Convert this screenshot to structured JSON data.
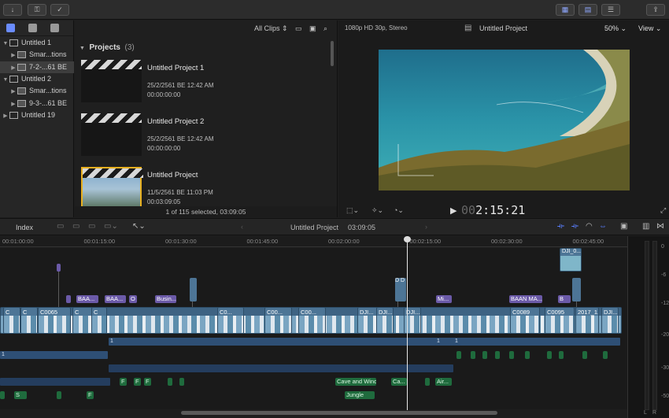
{
  "library": {
    "items": [
      {
        "label": "Untitled 1",
        "expanded": true,
        "level": 0
      },
      {
        "label": "Smar...tions",
        "level": 1
      },
      {
        "label": "7-2-...61 BE",
        "level": 1,
        "selected": true
      },
      {
        "label": "Untitled 2",
        "expanded": true,
        "level": 0
      },
      {
        "label": "Smar...tions",
        "level": 1
      },
      {
        "label": "9-3-...61 BE",
        "level": 1
      },
      {
        "label": "Untitled 19",
        "level": 0
      }
    ]
  },
  "browser": {
    "filter": "All Clips",
    "section_title": "Projects",
    "section_count": "(3)",
    "projects": [
      {
        "name": "Untitled Project 1",
        "date": "25/2/2561 BE 12:42 AM",
        "duration": "00:00:00:00"
      },
      {
        "name": "Untitled Project 2",
        "date": "25/2/2561 BE 12:42 AM",
        "duration": "00:00:00:00"
      },
      {
        "name": "Untitled Project",
        "date": "11/5/2561 BE 11:03 PM",
        "duration": "00:03:09:05"
      }
    ],
    "status": "1 of 115 selected, 03:09:05"
  },
  "viewer": {
    "format": "1080p HD 30p, Stereo",
    "title": "Untitled Project",
    "zoom": "50%",
    "view_label": "View",
    "timecode_dim": "00",
    "timecode": "2:15:21"
  },
  "timeline": {
    "index_label": "Index",
    "project_name": "Untitled Project",
    "duration": "03:09:05",
    "ruler": [
      "00:01:00:00",
      "00:01:15:00",
      "00:01:30:00",
      "00:01:45:00",
      "00:02:00:00",
      "00:02:15:00",
      "00:02:30:00",
      "00:02:45:00"
    ],
    "main_clip_labels": [
      "C",
      "C",
      "C0065",
      "C",
      "C",
      "C0...",
      "C00...",
      "C00...",
      "DJI...",
      "DJI...",
      "DJI...",
      "C0089",
      "C0095",
      "2017_1...",
      "DJI..."
    ],
    "title_clips": [
      "BAA...",
      "BAA...",
      "O",
      "Busin...",
      "Mi...",
      "BAAN MA...",
      "B"
    ],
    "connected_top": "DJI_0...",
    "audio_labels": [
      "Cave and Wind",
      "Jungle",
      "Ca...",
      "Air...",
      "S",
      "F",
      "F",
      "F",
      "F"
    ],
    "blue_bar_labels": [
      "1",
      "1",
      "1",
      "1"
    ]
  },
  "meters": {
    "scale": [
      "0",
      "-6",
      "-12",
      "-20",
      "-30",
      "-50"
    ],
    "channels": [
      "L",
      "R"
    ]
  }
}
